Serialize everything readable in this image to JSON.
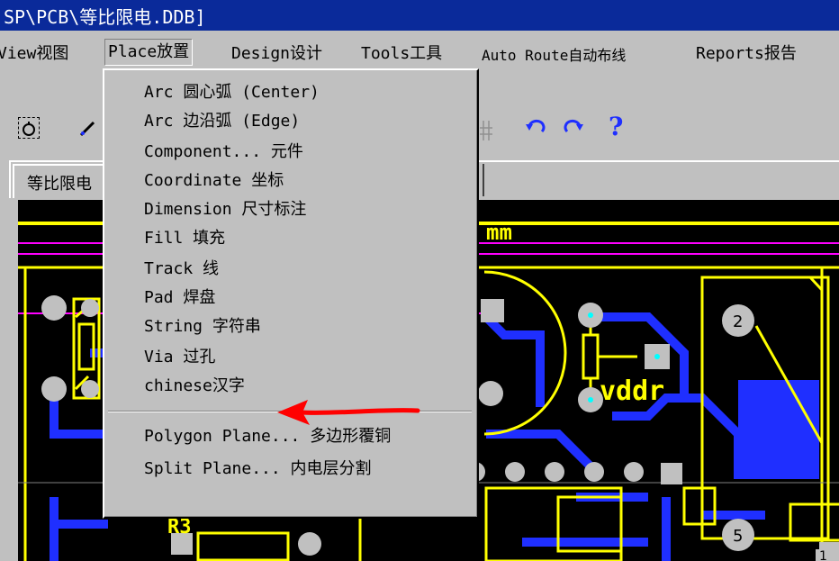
{
  "window": {
    "title": "SP\\PCB\\等比限电.DDB]"
  },
  "menubar": {
    "items": [
      {
        "label": "View视图",
        "u": ""
      },
      {
        "label": "Place放置",
        "u": ""
      },
      {
        "label": "Design设计",
        "u": ""
      },
      {
        "label": "Tools工具",
        "u": ""
      },
      {
        "label": "Auto Route自动布线",
        "u": ""
      },
      {
        "label": "Reports报告",
        "u": ""
      }
    ]
  },
  "toolbar": {
    "undo_icon": "undo-icon",
    "redo_icon": "redo-icon",
    "help_label": "?"
  },
  "document_tab": {
    "label": "等比限电"
  },
  "place_menu": {
    "items": [
      {
        "label": "Arc 圆心弧 (Center)"
      },
      {
        "label": "Arc 边沿弧 (Edge)"
      },
      {
        "label": "Component... 元件"
      },
      {
        "label": "Coordinate 坐标"
      },
      {
        "label": "Dimension 尺寸标注"
      },
      {
        "label": "Fill 填充"
      },
      {
        "label": "Track 线"
      },
      {
        "label": "Pad 焊盘"
      },
      {
        "label": "String 字符串"
      },
      {
        "label": "Via 过孔"
      },
      {
        "label": "chinese汉字"
      },
      {
        "label": "Polygon Plane... 多边形覆铜"
      },
      {
        "label": "Split Plane... 内电层分割"
      }
    ]
  },
  "pcb": {
    "labels": {
      "mm": "mm",
      "vddr": "vddr",
      "r3": "R3",
      "pad2": "2",
      "pad5": "5",
      "pad1": "1"
    }
  },
  "colors": {
    "title_bar": "#0a2a9a",
    "menu_bg": "#c0c0c0",
    "pcb_bg": "#000000",
    "track_blue": "#1f2fff",
    "silk_yellow": "#ffff00",
    "pad_grey": "#c0c0c0",
    "magenta": "#ff00ff",
    "arrow_red": "#ff0000"
  }
}
